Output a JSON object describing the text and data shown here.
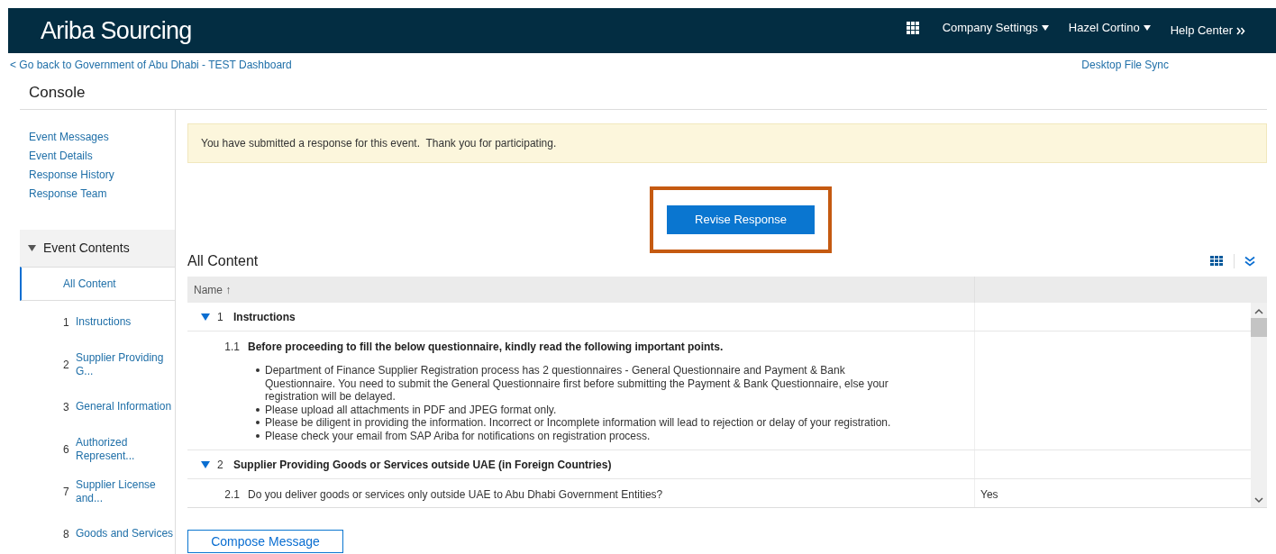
{
  "header": {
    "title": "Ariba Sourcing",
    "menus": [
      {
        "label": "Company Settings",
        "kind": "dropdown"
      },
      {
        "label": "Hazel Cortino",
        "kind": "dropdown"
      },
      {
        "label": "Help Center",
        "kind": "more"
      }
    ]
  },
  "back_link": "< Go back to Government of Abu Dhabi - TEST Dashboard",
  "desktop_link": "Desktop File Sync",
  "page_title": "Console",
  "sidebar": {
    "links": [
      "Event Messages",
      "Event Details",
      "Response History",
      "Response Team"
    ],
    "contents": {
      "title": "Event Contents",
      "expanded": true,
      "items": [
        {
          "label": "All Content",
          "selected": true
        },
        {
          "number": "1",
          "label": "Instructions",
          "selected": false
        },
        {
          "number": "2",
          "label": "Supplier Providing G...",
          "selected": false
        },
        {
          "number": "3",
          "label": "General Information",
          "selected": false
        },
        {
          "number": "6",
          "label": "Authorized Represent...",
          "selected": false
        },
        {
          "number": "7",
          "label": "Supplier License and...",
          "selected": false
        },
        {
          "number": "8",
          "label": "Goods and Services",
          "selected": false
        }
      ]
    }
  },
  "notice": "You have submitted a response for this event.  Thank you for participating.",
  "revise_button": {
    "label": "Revise Response",
    "highlighted": true
  },
  "content": {
    "title": "All Content",
    "columns": [
      "Name ↑"
    ],
    "rows": [
      {
        "kind": "section",
        "number": "1",
        "title": "Instructions",
        "expanded": true
      },
      {
        "kind": "question",
        "item_number": "1.1",
        "title": "Before proceeding to fill the below questionnaire, kindly read the following important points.",
        "emphasis": true,
        "bullets": [
          "Department of Finance Supplier Registration process has 2 questionnaires - General Questionnaire and Payment & Bank Questionnaire. You need to submit the General Questionnaire first before submitting the Payment & Bank Questionnaire, else your registration will be delayed.",
          "Please upload all attachments in PDF and JPEG format only.",
          "Please be diligent in providing the information. Incorrect or Incomplete information will lead to rejection or delay of your registration.",
          "Please check your email from SAP Ariba for notifications on registration process."
        ]
      },
      {
        "kind": "section",
        "number": "2",
        "title": "Supplier Providing Goods or Services outside UAE (in Foreign Countries)",
        "expanded": true
      },
      {
        "kind": "question",
        "item_number": "2.1",
        "title": "Do you deliver goods or services only outside UAE to Abu Dhabi Government Entities?",
        "emphasis": false,
        "answer": "Yes"
      }
    ]
  },
  "compose_button": "Compose Message"
}
